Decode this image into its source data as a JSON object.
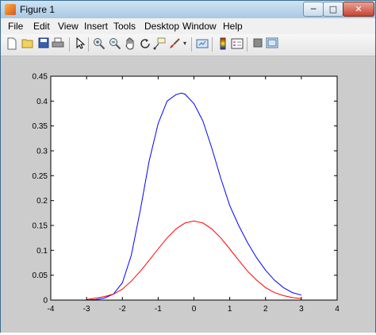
{
  "window": {
    "title": "Figure 1",
    "controls": {
      "minimize": "─",
      "maximize": "□",
      "close": "✕"
    }
  },
  "menubar": {
    "items": [
      "File",
      "Edit",
      "View",
      "Insert",
      "Tools",
      "Desktop",
      "Window",
      "Help"
    ]
  },
  "toolbar": {
    "icons": [
      "new-figure-icon",
      "open-file-icon",
      "save-icon",
      "print-icon",
      "edit-plot-arrow-icon",
      "zoom-in-icon",
      "zoom-out-icon",
      "pan-hand-icon",
      "rotate-3d-icon",
      "data-cursor-icon",
      "brush-icon",
      "brush-dropdown-icon",
      "link-plot-icon",
      "insert-colorbar-icon",
      "insert-legend-icon",
      "hide-plot-tools-icon",
      "show-plot-tools-icon"
    ]
  },
  "chart_data": {
    "type": "line",
    "title": "",
    "xlabel": "",
    "ylabel": "",
    "xlim": [
      -4,
      4
    ],
    "ylim": [
      0,
      0.45
    ],
    "xticks": [
      "-4",
      "-3",
      "-2",
      "-1",
      "0",
      "1",
      "2",
      "3",
      "4"
    ],
    "yticks": [
      "0",
      "0.05",
      "0.1",
      "0.15",
      "0.2",
      "0.25",
      "0.3",
      "0.35",
      "0.4",
      "0.45"
    ],
    "grid": false,
    "series": [
      {
        "color": "#0000ff",
        "x": [
          -3.0,
          -2.75,
          -2.5,
          -2.25,
          -2.0,
          -1.75,
          -1.5,
          -1.25,
          -1.0,
          -0.75,
          -0.5,
          -0.35,
          -0.25,
          0.0,
          0.25,
          0.5,
          0.75,
          1.0,
          1.25,
          1.5,
          1.75,
          2.0,
          2.25,
          2.5,
          2.75,
          3.0
        ],
        "y": [
          0.0,
          0.001,
          0.004,
          0.012,
          0.035,
          0.09,
          0.18,
          0.28,
          0.355,
          0.4,
          0.413,
          0.416,
          0.414,
          0.395,
          0.36,
          0.305,
          0.245,
          0.19,
          0.15,
          0.115,
          0.085,
          0.06,
          0.04,
          0.025,
          0.015,
          0.01
        ]
      },
      {
        "color": "#ff0000",
        "x": [
          -3.0,
          -2.75,
          -2.5,
          -2.25,
          -2.0,
          -1.75,
          -1.5,
          -1.25,
          -1.0,
          -0.75,
          -0.5,
          -0.25,
          0.0,
          0.25,
          0.5,
          0.75,
          1.0,
          1.25,
          1.5,
          1.75,
          2.0,
          2.25,
          2.5,
          2.75,
          3.0
        ],
        "y": [
          0.001,
          0.004,
          0.007,
          0.012,
          0.022,
          0.038,
          0.058,
          0.08,
          0.103,
          0.125,
          0.143,
          0.155,
          0.159,
          0.155,
          0.143,
          0.125,
          0.103,
          0.08,
          0.058,
          0.04,
          0.025,
          0.015,
          0.009,
          0.005,
          0.003
        ]
      }
    ]
  }
}
